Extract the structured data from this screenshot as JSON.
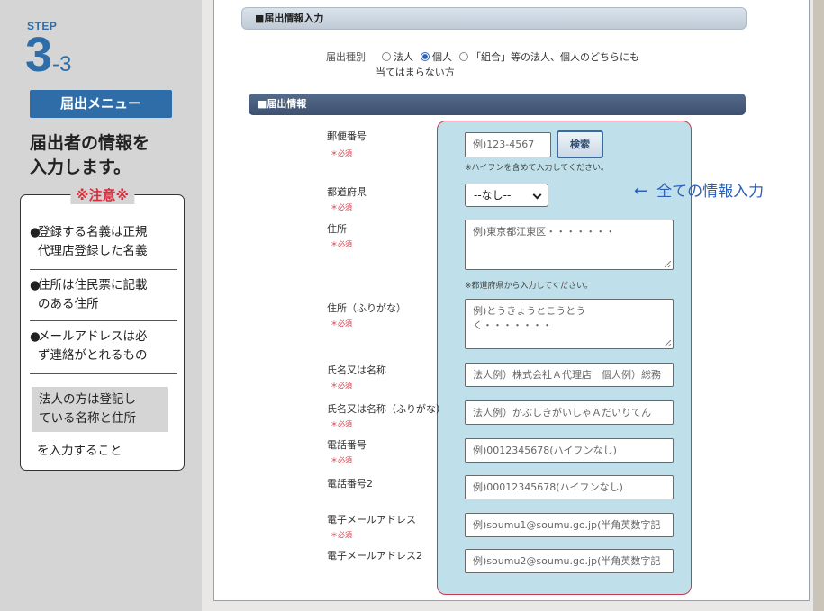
{
  "guide": {
    "step_label": "STEP",
    "step_number": "3",
    "step_sub": "-3",
    "menu_badge": "届出メニュー",
    "heading_line1": "届出者の情報を",
    "heading_line2": "入力します。",
    "note_title": "※注意※",
    "notes": [
      {
        "bullet": "●",
        "line1": "登録する名義は正規",
        "line2": "代理店登録した名義"
      },
      {
        "bullet": "●",
        "line1": "住所は住民票に記載",
        "line2": "のある住所"
      },
      {
        "bullet": "●",
        "line1": "メールアドレスは必",
        "line2": "ず連絡がとれるもの"
      }
    ],
    "gray_line1": "法人の方は登記し",
    "gray_line2": "ている名称と住所",
    "tail": "を入力すること"
  },
  "form": {
    "section1_title": "■届出情報入力",
    "type_label": "届出種別",
    "type_options": [
      "法人",
      "個人",
      "「組合」等の法人、個人のどちらにも"
    ],
    "type_option3_cont": "当てはまらない方",
    "type_selected": "個人",
    "section2_title": "■届出情報",
    "required_mark": "＊必須",
    "fields": {
      "postal": {
        "label": "郵便番号",
        "placeholder": "例)123-4567",
        "hint": "※ハイフンを含めて入力してください。"
      },
      "search_button": "検索",
      "prefecture": {
        "label": "都道府県",
        "selected": "--なし--"
      },
      "address": {
        "label": "住所",
        "placeholder": "例)東京都江東区・・・・・・・",
        "hint": "※都道府県から入力してください。"
      },
      "address_kana": {
        "label": "住所（ふりがな）",
        "placeholder_line1": "例)とうきょうとこうとう",
        "placeholder_line2": "く・・・・・・・"
      },
      "name": {
        "label": "氏名又は名称",
        "placeholder": "法人例）株式会社Ａ代理店　個人例）総務"
      },
      "name_kana": {
        "label": "氏名又は名称（ふりがな）",
        "placeholder": "法人例）かぶしきがいしゃＡだいりてん"
      },
      "phone": {
        "label": "電話番号",
        "placeholder": "例)0012345678(ハイフンなし)"
      },
      "phone2": {
        "label": "電話番号2",
        "placeholder": "例)00012345678(ハイフンなし)"
      },
      "email": {
        "label": "電子メールアドレス",
        "placeholder": "例)soumu1@soumu.go.jp(半角英数字記"
      },
      "email2": {
        "label": "電子メールアドレス2",
        "placeholder": "例)soumu2@soumu.go.jp(半角英数字記"
      }
    },
    "callout_arrow": "←",
    "callout_text": "全ての情報入力"
  },
  "colors": {
    "accent_blue": "#2f6da8",
    "required_red": "#d6303e",
    "highlight_fill": "#bfe0ea",
    "highlight_border": "#c93a4d"
  }
}
